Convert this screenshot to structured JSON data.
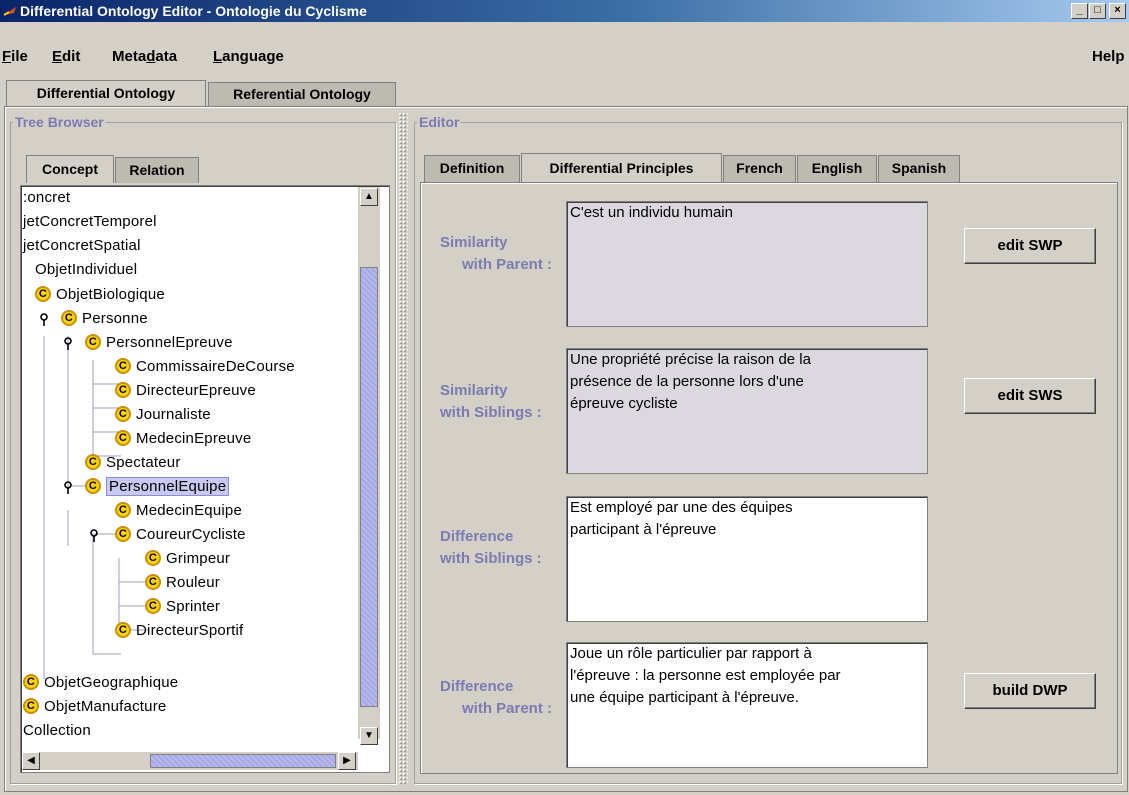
{
  "window": {
    "title": "Differential Ontology Editor - Ontologie du Cyclisme",
    "controls": [
      "_",
      "□",
      "×"
    ]
  },
  "menubar": {
    "file": {
      "key": "F",
      "rest": "ile"
    },
    "edit": {
      "key": "E",
      "rest": "dit"
    },
    "metadata": {
      "pre": "Meta",
      "key": "d",
      "rest": "ata"
    },
    "language": {
      "key": "L",
      "rest": "anguage"
    },
    "help": "Help"
  },
  "ontology_tabs": [
    "Differential Ontology",
    "Referential Ontology"
  ],
  "tree_browser": {
    "legend": "Tree Browser",
    "tabs": [
      "Concept",
      "Relation"
    ],
    "concept_icon_glyph": "C",
    "items": [
      {
        "text": ":oncret"
      },
      {
        "text": "jetConcretTemporel"
      },
      {
        "text": "jetConcretSpatial"
      },
      {
        "text": "ObjetIndividuel"
      },
      {
        "text": "ObjetBiologique"
      },
      {
        "text": "Personne"
      },
      {
        "text": "PersonnelEpreuve"
      },
      {
        "text": "CommissaireDeCourse"
      },
      {
        "text": "DirecteurEpreuve"
      },
      {
        "text": "Journaliste"
      },
      {
        "text": "MedecinEpreuve"
      },
      {
        "text": "Spectateur"
      },
      {
        "text": "PersonnelEquipe"
      },
      {
        "text": "MedecinEquipe"
      },
      {
        "text": "CoureurCycliste"
      },
      {
        "text": "Grimpeur"
      },
      {
        "text": "Rouleur"
      },
      {
        "text": "Sprinter"
      },
      {
        "text": "DirecteurSportif"
      },
      {
        "text": "ObjetGeographique"
      },
      {
        "text": "ObjetManufacture"
      },
      {
        "text": "Collection"
      }
    ],
    "selected_item": "PersonnelEquipe"
  },
  "editor": {
    "legend": "Editor",
    "tabs": [
      "Definition",
      "Differential Principles",
      "French",
      "English",
      "Spanish"
    ],
    "active_tab": "Differential Principles",
    "principles": [
      {
        "label_line1": "Similarity",
        "label_line2": "with Parent :",
        "text": "C'est un individu humain",
        "button": "edit SWP"
      },
      {
        "label_line1": "Similarity",
        "label_line2": "with Siblings :",
        "text": "Une propriété précise la raison de la\nprésence de la personne lors d'une\népreuve cycliste",
        "button": "edit SWS"
      },
      {
        "label_line1": "Difference",
        "label_line2": "with Siblings :",
        "text": "Est employé par une des équipes\nparticipant à l'épreuve",
        "button": ""
      },
      {
        "label_line1": "Difference",
        "label_line2": "with Parent :",
        "text": "Joue un rôle particulier par rapport à\nl'épreuve : la personne est employée par\nune équipe participant à l'épreuve.",
        "button": "build DWP"
      }
    ]
  },
  "colors": {
    "accent_label": "#7b7bb0",
    "selection": "#c8c8f0",
    "concept_icon": "#ffd400",
    "title_bar": "#0a246a"
  }
}
